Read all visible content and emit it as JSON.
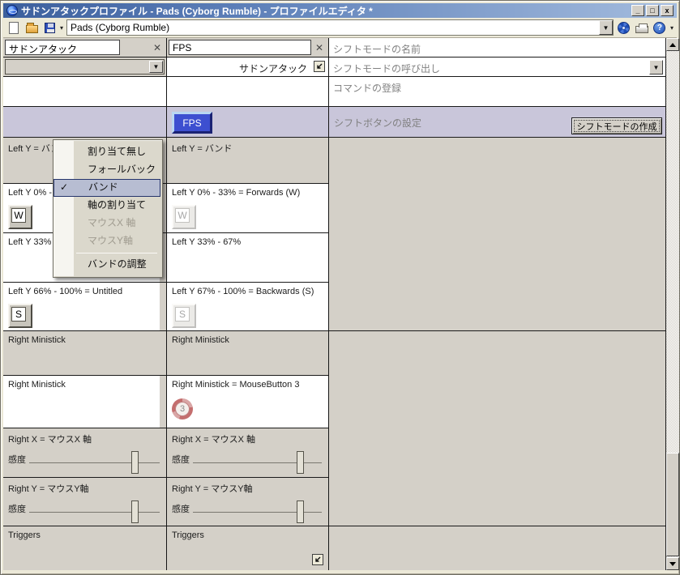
{
  "window": {
    "title": "サドンアタックプロファイル - Pads (Cyborg Rumble) - プロファイルエディタ *",
    "minimize_glyph": "_",
    "maximize_glyph": "□",
    "close_glyph": "x"
  },
  "toolbar": {
    "profile_name": "Pads (Cyborg Rumble)",
    "help_glyph": "?"
  },
  "icons": {
    "dropdown_glyph": "▼",
    "close_x_glyph": "✕"
  },
  "mode1": {
    "name": "サドンアタック",
    "cells": {
      "left_y": "Left Y = バンド",
      "band1": "Left Y 0% - ",
      "band1_key": "W",
      "band2": "Left Y 33%",
      "band3": "Left Y 66% - 100% = Untitled",
      "band3_key": "S",
      "ministick_header": "Right Ministick",
      "ministick": "Right Ministick",
      "right_x": "Right X = マウスX 軸",
      "right_y": "Right Y = マウスY軸",
      "sensitivity": "感度",
      "triggers": "Triggers"
    }
  },
  "mode2": {
    "name": "FPS",
    "parent_mode": "サドンアタック",
    "shift_key_label": "FPS",
    "cells": {
      "left_y": "Left Y = バンド",
      "band1": "Left Y 0% - 33% = Forwards (W)",
      "band1_key": "W",
      "band2": "Left Y 33% - 67%",
      "band3": "Left Y 67% - 100% = Backwards (S)",
      "band3_key": "S",
      "ministick_header": "Right Ministick",
      "ministick": "Right Ministick = MouseButton 3",
      "mouse_button_number": "3",
      "right_x": "Right X = マウスX 軸",
      "right_y": "Right Y = マウスY軸",
      "sensitivity": "感度",
      "triggers": "Triggers"
    }
  },
  "shift_panel": {
    "name_field": "シフトモードの名前",
    "call_field": "シフトモードの呼び出し",
    "command_label": "コマンドの登録",
    "setting_label": "シフトボタンの設定",
    "create_button": "シフトモードの作成"
  },
  "context_menu": {
    "check_glyph": "✓",
    "items": [
      {
        "label": "割り当て無し",
        "state": "normal"
      },
      {
        "label": "フォールバック",
        "state": "normal"
      },
      {
        "label": "バンド",
        "state": "checked"
      },
      {
        "label": "軸の割り当て",
        "state": "normal"
      },
      {
        "label": "マウスX 軸",
        "state": "disabled"
      },
      {
        "label": "マウスY軸",
        "state": "disabled"
      },
      {
        "label": "バンドの調整",
        "state": "normal"
      }
    ]
  }
}
